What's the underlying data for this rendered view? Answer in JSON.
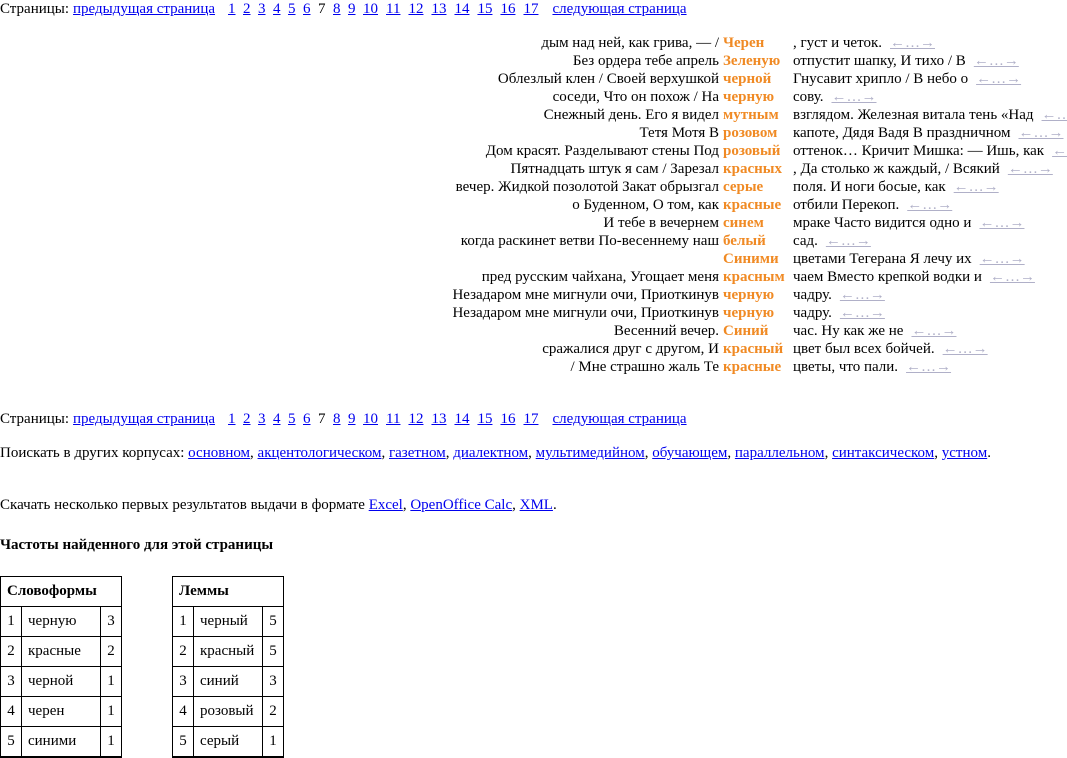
{
  "pager": {
    "label": "Страницы:",
    "prev": "предыдущая страница",
    "next": "следующая страница",
    "pages": [
      "1",
      "2",
      "3",
      "4",
      "5",
      "6",
      "7",
      "8",
      "9",
      "10",
      "11",
      "12",
      "13",
      "14",
      "15",
      "16",
      "17"
    ],
    "current": "7"
  },
  "context_link": "←…→",
  "concordance": [
    {
      "left": "дым над ней, как грива, — /",
      "kw": "Черен",
      "right": ", густ и четок."
    },
    {
      "left": "Без ордера тебе апрель",
      "kw": "Зеленую",
      "right": "отпустит шапку, И тихо / В"
    },
    {
      "left": "Облезлый клен / Своей верхушкой",
      "kw": "черной",
      "right": "Гнусавит хрипло / В небо о"
    },
    {
      "left": "соседи, Что он похож / На",
      "kw": "черную",
      "right": "сову."
    },
    {
      "left": "Снежный день. Его я видел",
      "kw": "мутным",
      "right": "взглядом. Железная витала тень «Над"
    },
    {
      "left": "Тетя Мотя В",
      "kw": "розовом",
      "right": "капоте, Дядя Вадя В праздничном"
    },
    {
      "left": "Дом красят. Разделывают стены Под",
      "kw": "розовый",
      "right": "оттенок… Кричит Мишка: — Ишь, как"
    },
    {
      "left": "Пятнадцать штук я сам / Зарезал",
      "kw": "красных",
      "right": ", Да столько ж каждый, / Всякий"
    },
    {
      "left": "вечер. Жидкой позолотой Закат обрызгал",
      "kw": "серые",
      "right": "поля. И ноги босые, как"
    },
    {
      "left": "о Буденном, О том, как",
      "kw": "красные",
      "right": "отбили Перекоп."
    },
    {
      "left": "И тебе в вечернем",
      "kw": "синем",
      "right": "мраке Часто видится одно и"
    },
    {
      "left": "когда раскинет ветви По-весеннему наш",
      "kw": "белый",
      "right": "сад."
    },
    {
      "left": "",
      "kw": "Синими",
      "right": "цветами Тегерана Я лечу их"
    },
    {
      "left": "пред русским чайхана, Угощает меня",
      "kw": "красным",
      "right": "чаем Вместо крепкой водки и"
    },
    {
      "left": "Незадаром мне мигнули очи, Приоткинув",
      "kw": "черную",
      "right": "чадру."
    },
    {
      "left": "Незадаром мне мигнули очи, Приоткинув",
      "kw": "черную",
      "right": "чадру."
    },
    {
      "left": "Весенний вечер.",
      "kw": "Синий",
      "right": "час. Ну как же не"
    },
    {
      "left": "сражалися друг с другом, И",
      "kw": "красный",
      "right": "цвет был всех бойчей."
    },
    {
      "left": "/ Мне страшно жаль Те",
      "kw": "красные",
      "right": "цветы, что пали."
    }
  ],
  "other_corpora": {
    "label": "Поискать в других корпусах:",
    "links": [
      "основном",
      "акцентологическом",
      "газетном",
      "диалектном",
      "мультимедийном",
      "обучающем",
      "параллельном",
      "синтаксическом",
      "устном"
    ]
  },
  "download": {
    "label": "Скачать несколько первых результатов выдачи в формате",
    "links": [
      "Excel",
      "OpenOffice Calc",
      "XML"
    ]
  },
  "freq": {
    "heading": "Частоты найденного для этой страницы",
    "wordforms": {
      "title": "Словоформы",
      "rows": [
        [
          "1",
          "черную",
          "3"
        ],
        [
          "2",
          "красные",
          "2"
        ],
        [
          "3",
          "черной",
          "1"
        ],
        [
          "4",
          "черен",
          "1"
        ],
        [
          "5",
          "синими",
          "1"
        ]
      ]
    },
    "lemmas": {
      "title": "Леммы",
      "rows": [
        [
          "1",
          "черный",
          "5"
        ],
        [
          "2",
          "красный",
          "5"
        ],
        [
          "3",
          "синий",
          "3"
        ],
        [
          "4",
          "розовый",
          "2"
        ],
        [
          "5",
          "серый",
          "1"
        ]
      ]
    }
  }
}
